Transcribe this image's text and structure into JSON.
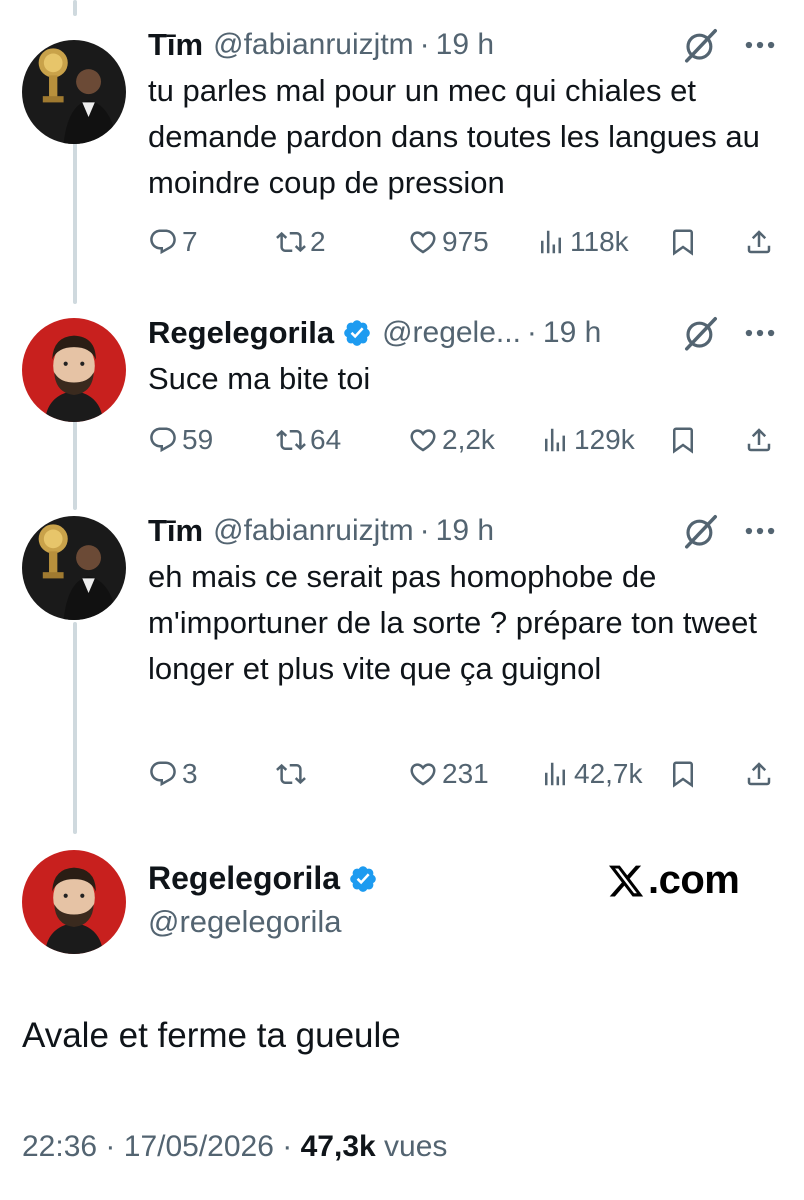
{
  "tweets": [
    {
      "name": "Tīm",
      "handle": "@fabianruizjtm",
      "time": "19 h",
      "verified": false,
      "text": "tu parles mal pour un mec qui chiales et demande pardon dans toutes les langues au moindre coup de pression",
      "replies": "7",
      "retweets": "2",
      "likes": "975",
      "views": "118k"
    },
    {
      "name": "Regelegorila",
      "handle": "@regele...",
      "time": "19 h",
      "verified": true,
      "text": "Suce ma bite toi",
      "replies": "59",
      "retweets": "64",
      "likes": "2,2k",
      "views": "129k"
    },
    {
      "name": "Tīm",
      "handle": "@fabianruizjtm",
      "time": "19 h",
      "verified": false,
      "text": "eh mais ce serait pas homophobe de m'importuner de la sorte ? prépare ton tweet longer et plus vite que ça guignol",
      "replies": "3",
      "retweets": "",
      "likes": "231",
      "views": "42,7k"
    }
  ],
  "main_tweet": {
    "name": "Regelegorila",
    "handle": "@regelegorila",
    "verified": true,
    "text": "Avale et ferme ta gueule",
    "time": "22:36",
    "date": "17/05/2026",
    "views_count": "47,3k",
    "views_label": "vues"
  },
  "watermark": ".com",
  "separator": "·",
  "colors": {
    "secondary": "#536471",
    "verified": "#1d9bf0",
    "text": "#0f1419"
  }
}
